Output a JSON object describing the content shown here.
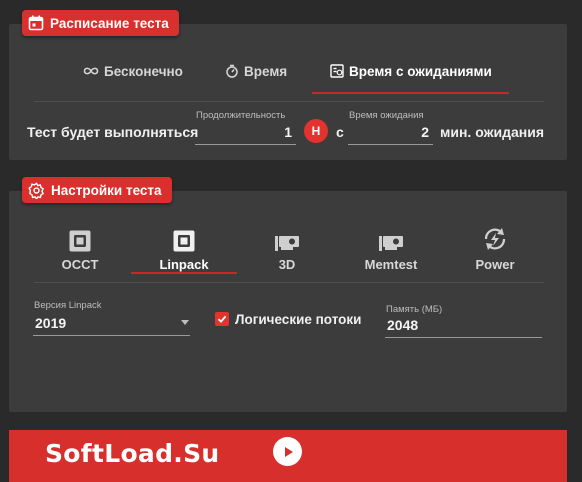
{
  "schedule": {
    "title": "Расписание теста",
    "tabs": [
      {
        "label": "Бесконечно",
        "icon": "infinity-icon"
      },
      {
        "label": "Время",
        "icon": "timer-icon"
      },
      {
        "label": "Время с ожиданиями",
        "icon": "timer-list-icon",
        "active": true
      }
    ],
    "run_label": "Тест будет выполняться",
    "duration": {
      "label": "Продолжительность",
      "value": "1"
    },
    "unit_h": "Н",
    "unit_c": "с",
    "wait": {
      "label": "Время ожидания",
      "value": "2"
    },
    "wait_suffix": "мин. ожидания"
  },
  "settings": {
    "title": "Настройки теста",
    "tabs": [
      {
        "label": "OCCT",
        "icon": "chip-icon"
      },
      {
        "label": "Linpack",
        "icon": "chip-icon",
        "active": true
      },
      {
        "label": "3D",
        "icon": "gpu-icon"
      },
      {
        "label": "Memtest",
        "icon": "gpu-icon"
      },
      {
        "label": "Power",
        "icon": "power-cycle-icon"
      }
    ],
    "version": {
      "label": "Версия Linpack",
      "value": "2019"
    },
    "logical_threads": {
      "label": "Логические потоки",
      "checked": true
    },
    "memory": {
      "label": "Память (МБ)",
      "value": "2048"
    }
  },
  "banner": {
    "brand": "SoftLoad.Su"
  },
  "colors": {
    "accent": "#d9302d",
    "panel": "#3c3c3c",
    "background": "#2a2a2a"
  }
}
